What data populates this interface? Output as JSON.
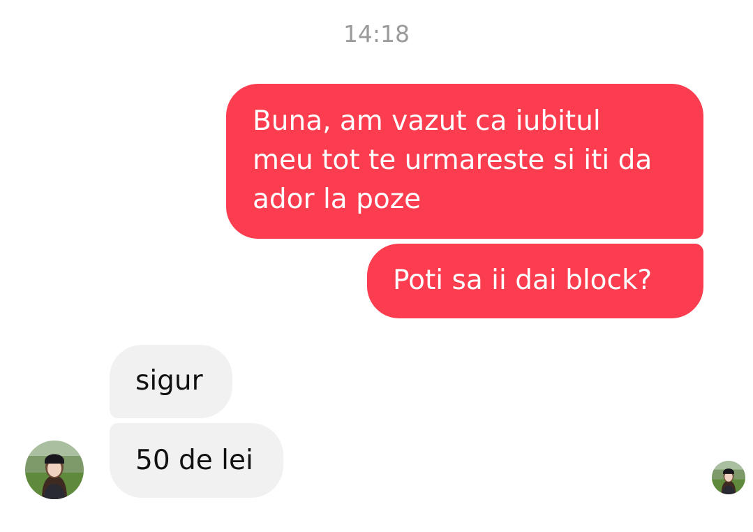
{
  "chat": {
    "timestamp": "14:18",
    "messages": [
      {
        "sender": "me",
        "text": "Buna, am vazut ca iubitul\nmeu tot te urmareste si iti da\nador la poze"
      },
      {
        "sender": "me",
        "text": "Poti sa ii dai block?"
      },
      {
        "sender": "contact",
        "text": "sigur"
      },
      {
        "sender": "contact",
        "text": "50 de lei"
      }
    ]
  },
  "colors": {
    "sent_bubble": "#fc3d4f",
    "received_bubble": "#f1f1f1",
    "timestamp_text": "#9a9a9a"
  },
  "icons": {
    "contact_avatar": "contact-avatar-photo",
    "seen_indicator": "seen-avatar-photo"
  }
}
